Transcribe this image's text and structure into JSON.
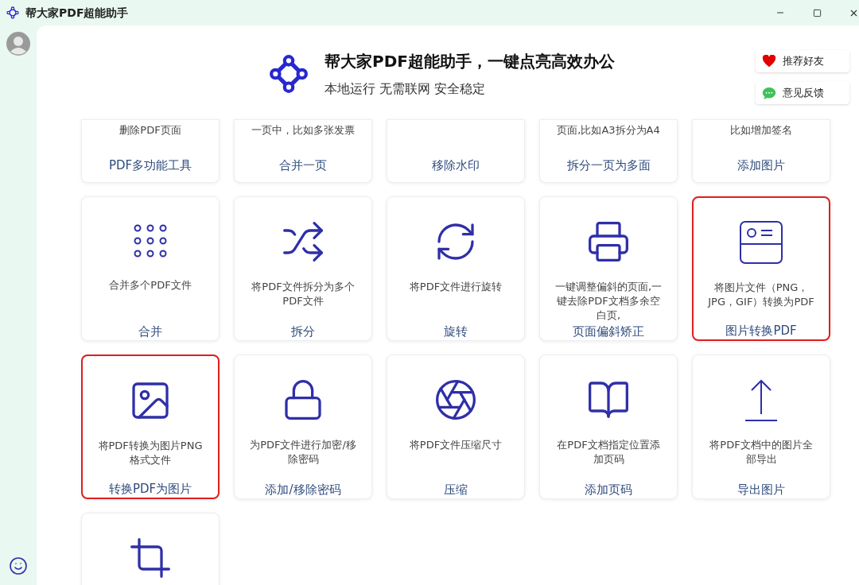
{
  "window": {
    "title": "帮大家PDF超能助手"
  },
  "header": {
    "title": "帮大家PDF超能助手，一键点亮高效办公",
    "subtitle": "本地运行 无需联网 安全稳定",
    "buttons": [
      {
        "label": "推荐好友",
        "kind": "heart"
      },
      {
        "label": "意见反馈",
        "kind": "chat"
      }
    ]
  },
  "tool_rows": [
    {
      "cards": [
        {
          "description": "删除PDF页面",
          "label": "PDF多功能工具",
          "highlighted": false
        },
        {
          "description": "一页中，比如多张发票",
          "label": "合并一页",
          "highlighted": false
        },
        {
          "label": "移除水印",
          "highlighted": false
        },
        {
          "description": "页面,比如A3拆分为A4",
          "label": "拆分一页为多面",
          "highlighted": false
        },
        {
          "description": "比如增加签名",
          "label": "添加图片",
          "highlighted": false
        }
      ]
    },
    {
      "cards": [
        {
          "kind": "dots",
          "description": "合并多个PDF文件",
          "label": "合并",
          "highlighted": false
        },
        {
          "kind": "shuffle",
          "description": "将PDF文件拆分为多个PDF文件",
          "label": "拆分",
          "highlighted": false
        },
        {
          "kind": "rotate",
          "description": "将PDF文件进行旋转",
          "label": "旋转",
          "highlighted": false
        },
        {
          "kind": "printer",
          "description": "一键调整偏斜的页面,一键去除PDF文档多余空白页,",
          "label": "页面偏斜矫正",
          "highlighted": false
        },
        {
          "kind": "card",
          "description": "将图片文件（PNG，JPG，GIF）转换为PDF",
          "label": "图片转换PDF",
          "highlighted": true
        }
      ]
    },
    {
      "cards": [
        {
          "kind": "image",
          "description": "将PDF转换为图片PNG格式文件",
          "label": "转换PDF为图片",
          "highlighted": true
        },
        {
          "kind": "lock",
          "description": "为PDF文件进行加密/移除密码",
          "label": "添加/移除密码",
          "highlighted": false
        },
        {
          "kind": "aperture",
          "description": "将PDF文件压缩尺寸",
          "label": "压缩",
          "highlighted": false
        },
        {
          "kind": "book",
          "description": "在PDF文档指定位置添加页码",
          "label": "添加页码",
          "highlighted": false
        },
        {
          "kind": "upload",
          "description": "将PDF文档中的图片全部导出",
          "label": "导出图片",
          "highlighted": false
        }
      ]
    },
    {
      "cards": [
        {
          "kind": "crop",
          "highlighted": false
        }
      ]
    }
  ]
}
